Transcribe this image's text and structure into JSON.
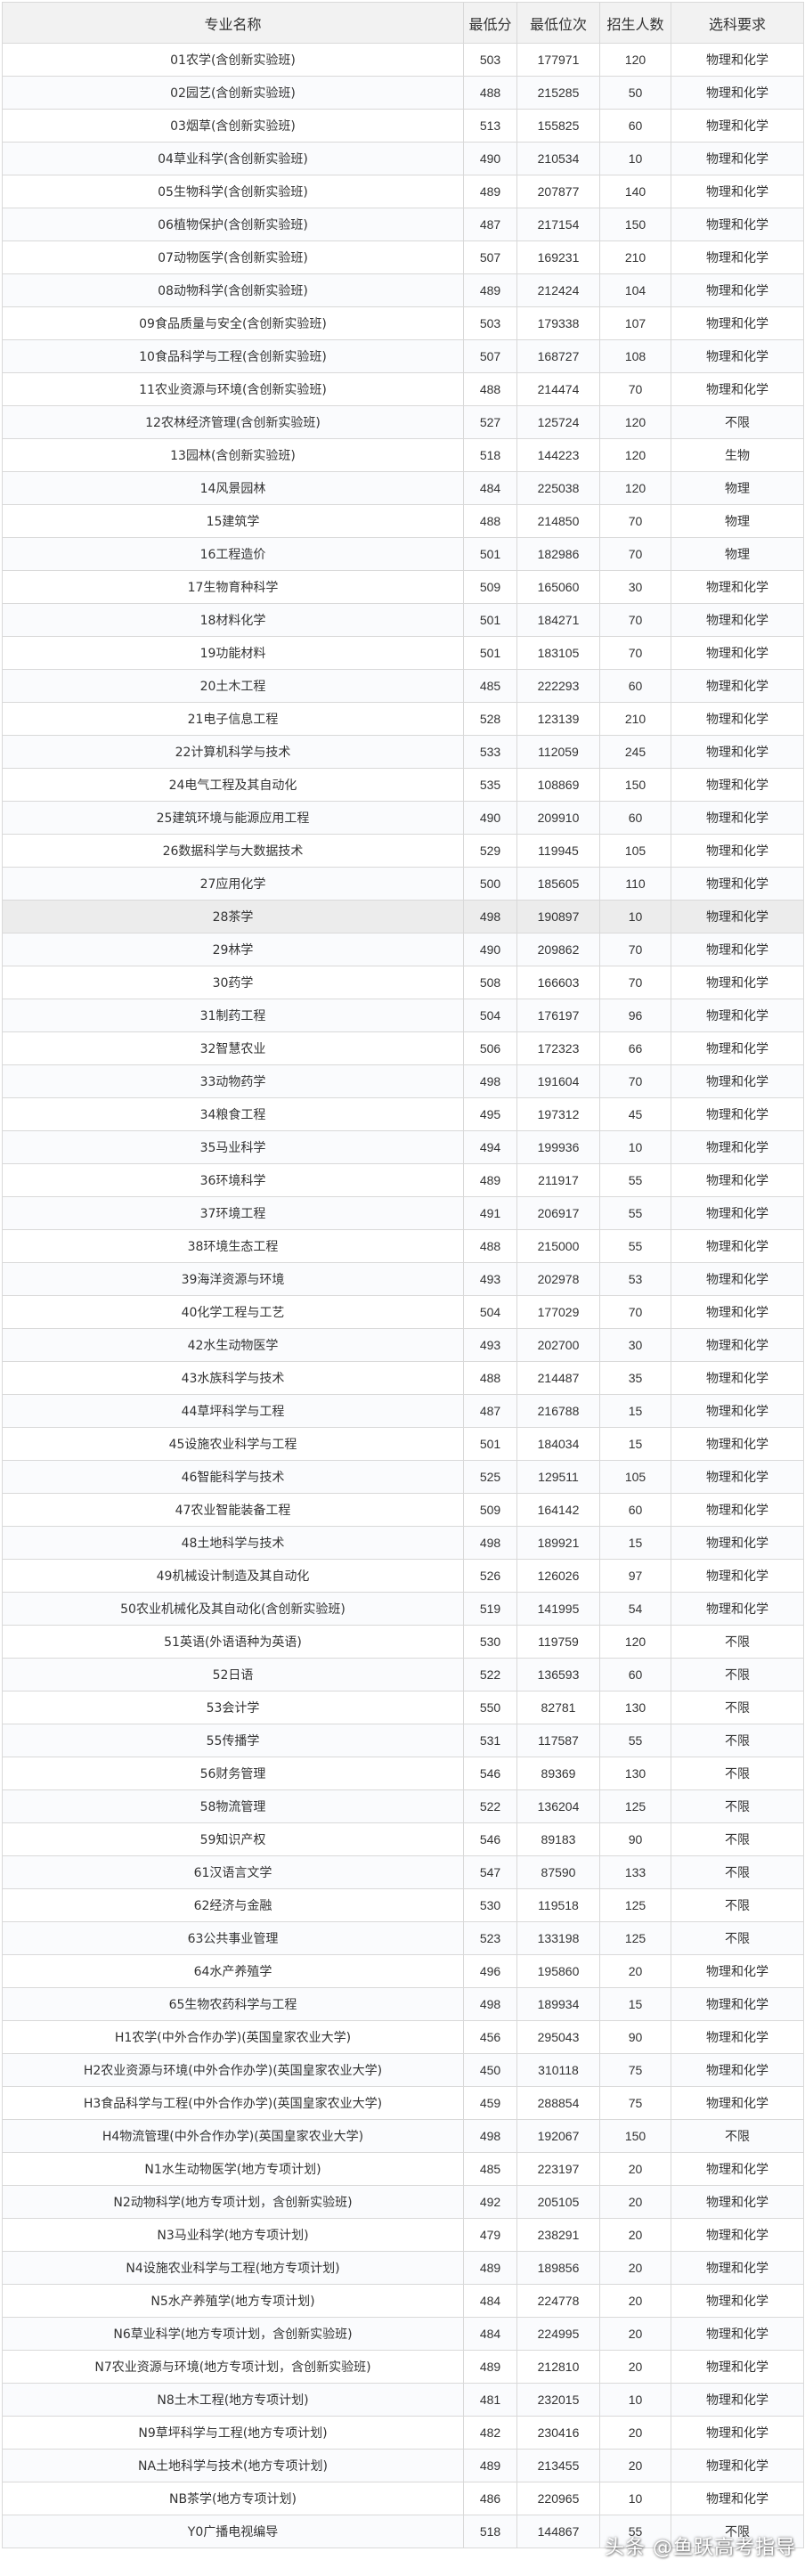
{
  "table": {
    "headers": [
      "专业名称",
      "最低分",
      "最低位次",
      "招生人数",
      "选科要求"
    ],
    "highlight_row": 27,
    "rows": [
      [
        "01农学(含创新实验班)",
        "503",
        "177971",
        "120",
        "物理和化学"
      ],
      [
        "02园艺(含创新实验班)",
        "488",
        "215285",
        "50",
        "物理和化学"
      ],
      [
        "03烟草(含创新实验班)",
        "513",
        "155825",
        "60",
        "物理和化学"
      ],
      [
        "04草业科学(含创新实验班)",
        "490",
        "210534",
        "10",
        "物理和化学"
      ],
      [
        "05生物科学(含创新实验班)",
        "489",
        "207877",
        "140",
        "物理和化学"
      ],
      [
        "06植物保护(含创新实验班)",
        "487",
        "217154",
        "150",
        "物理和化学"
      ],
      [
        "07动物医学(含创新实验班)",
        "507",
        "169231",
        "210",
        "物理和化学"
      ],
      [
        "08动物科学(含创新实验班)",
        "489",
        "212424",
        "104",
        "物理和化学"
      ],
      [
        "09食品质量与安全(含创新实验班)",
        "503",
        "179338",
        "107",
        "物理和化学"
      ],
      [
        "10食品科学与工程(含创新实验班)",
        "507",
        "168727",
        "108",
        "物理和化学"
      ],
      [
        "11农业资源与环境(含创新实验班)",
        "488",
        "214474",
        "70",
        "物理和化学"
      ],
      [
        "12农林经济管理(含创新实验班)",
        "527",
        "125724",
        "120",
        "不限"
      ],
      [
        "13园林(含创新实验班)",
        "518",
        "144223",
        "120",
        "生物"
      ],
      [
        "14风景园林",
        "484",
        "225038",
        "120",
        "物理"
      ],
      [
        "15建筑学",
        "488",
        "214850",
        "70",
        "物理"
      ],
      [
        "16工程造价",
        "501",
        "182986",
        "70",
        "物理"
      ],
      [
        "17生物育种科学",
        "509",
        "165060",
        "30",
        "物理和化学"
      ],
      [
        "18材料化学",
        "501",
        "184271",
        "70",
        "物理和化学"
      ],
      [
        "19功能材料",
        "501",
        "183105",
        "70",
        "物理和化学"
      ],
      [
        "20土木工程",
        "485",
        "222293",
        "60",
        "物理和化学"
      ],
      [
        "21电子信息工程",
        "528",
        "123139",
        "210",
        "物理和化学"
      ],
      [
        "22计算机科学与技术",
        "533",
        "112059",
        "245",
        "物理和化学"
      ],
      [
        "24电气工程及其自动化",
        "535",
        "108869",
        "150",
        "物理和化学"
      ],
      [
        "25建筑环境与能源应用工程",
        "490",
        "209910",
        "60",
        "物理和化学"
      ],
      [
        "26数据科学与大数据技术",
        "529",
        "119945",
        "105",
        "物理和化学"
      ],
      [
        "27应用化学",
        "500",
        "185605",
        "110",
        "物理和化学"
      ],
      [
        "28茶学",
        "498",
        "190897",
        "10",
        "物理和化学"
      ],
      [
        "29林学",
        "490",
        "209862",
        "70",
        "物理和化学"
      ],
      [
        "30药学",
        "508",
        "166603",
        "70",
        "物理和化学"
      ],
      [
        "31制药工程",
        "504",
        "176197",
        "96",
        "物理和化学"
      ],
      [
        "32智慧农业",
        "506",
        "172323",
        "66",
        "物理和化学"
      ],
      [
        "33动物药学",
        "498",
        "191604",
        "70",
        "物理和化学"
      ],
      [
        "34粮食工程",
        "495",
        "197312",
        "45",
        "物理和化学"
      ],
      [
        "35马业科学",
        "494",
        "199936",
        "10",
        "物理和化学"
      ],
      [
        "36环境科学",
        "489",
        "211917",
        "55",
        "物理和化学"
      ],
      [
        "37环境工程",
        "491",
        "206917",
        "55",
        "物理和化学"
      ],
      [
        "38环境生态工程",
        "488",
        "215000",
        "55",
        "物理和化学"
      ],
      [
        "39海洋资源与环境",
        "493",
        "202978",
        "53",
        "物理和化学"
      ],
      [
        "40化学工程与工艺",
        "504",
        "177029",
        "70",
        "物理和化学"
      ],
      [
        "42水生动物医学",
        "493",
        "202700",
        "30",
        "物理和化学"
      ],
      [
        "43水族科学与技术",
        "488",
        "214487",
        "35",
        "物理和化学"
      ],
      [
        "44草坪科学与工程",
        "487",
        "216788",
        "15",
        "物理和化学"
      ],
      [
        "45设施农业科学与工程",
        "501",
        "184034",
        "15",
        "物理和化学"
      ],
      [
        "46智能科学与技术",
        "525",
        "129511",
        "105",
        "物理和化学"
      ],
      [
        "47农业智能装备工程",
        "509",
        "164142",
        "60",
        "物理和化学"
      ],
      [
        "48土地科学与技术",
        "498",
        "189921",
        "15",
        "物理和化学"
      ],
      [
        "49机械设计制造及其自动化",
        "526",
        "126026",
        "97",
        "物理和化学"
      ],
      [
        "50农业机械化及其自动化(含创新实验班)",
        "519",
        "141995",
        "54",
        "物理和化学"
      ],
      [
        "51英语(外语语种为英语)",
        "530",
        "119759",
        "120",
        "不限"
      ],
      [
        "52日语",
        "522",
        "136593",
        "60",
        "不限"
      ],
      [
        "53会计学",
        "550",
        "82781",
        "130",
        "不限"
      ],
      [
        "55传播学",
        "531",
        "117587",
        "55",
        "不限"
      ],
      [
        "56财务管理",
        "546",
        "89369",
        "130",
        "不限"
      ],
      [
        "58物流管理",
        "522",
        "136204",
        "125",
        "不限"
      ],
      [
        "59知识产权",
        "546",
        "89183",
        "90",
        "不限"
      ],
      [
        "61汉语言文学",
        "547",
        "87590",
        "133",
        "不限"
      ],
      [
        "62经济与金融",
        "530",
        "119518",
        "125",
        "不限"
      ],
      [
        "63公共事业管理",
        "523",
        "133198",
        "125",
        "不限"
      ],
      [
        "64水产养殖学",
        "496",
        "195860",
        "20",
        "物理和化学"
      ],
      [
        "65生物农药科学与工程",
        "498",
        "189934",
        "15",
        "物理和化学"
      ],
      [
        "H1农学(中外合作办学)(英国皇家农业大学)",
        "456",
        "295043",
        "90",
        "物理和化学"
      ],
      [
        "H2农业资源与环境(中外合作办学)(英国皇家农业大学)",
        "450",
        "310118",
        "75",
        "物理和化学"
      ],
      [
        "H3食品科学与工程(中外合作办学)(英国皇家农业大学)",
        "459",
        "288854",
        "75",
        "物理和化学"
      ],
      [
        "H4物流管理(中外合作办学)(英国皇家农业大学)",
        "498",
        "192067",
        "150",
        "不限"
      ],
      [
        "N1水生动物医学(地方专项计划)",
        "485",
        "223197",
        "20",
        "物理和化学"
      ],
      [
        "N2动物科学(地方专项计划，含创新实验班)",
        "492",
        "205105",
        "20",
        "物理和化学"
      ],
      [
        "N3马业科学(地方专项计划)",
        "479",
        "238291",
        "20",
        "物理和化学"
      ],
      [
        "N4设施农业科学与工程(地方专项计划)",
        "489",
        "189856",
        "20",
        "物理和化学"
      ],
      [
        "N5水产养殖学(地方专项计划)",
        "484",
        "224778",
        "20",
        "物理和化学"
      ],
      [
        "N6草业科学(地方专项计划，含创新实验班)",
        "484",
        "224995",
        "20",
        "物理和化学"
      ],
      [
        "N7农业资源与环境(地方专项计划，含创新实验班)",
        "489",
        "212810",
        "20",
        "物理和化学"
      ],
      [
        "N8土木工程(地方专项计划)",
        "481",
        "232015",
        "10",
        "物理和化学"
      ],
      [
        "N9草坪科学与工程(地方专项计划)",
        "482",
        "230416",
        "20",
        "物理和化学"
      ],
      [
        "NA土地科学与技术(地方专项计划)",
        "489",
        "213455",
        "20",
        "物理和化学"
      ],
      [
        "NB茶学(地方专项计划)",
        "486",
        "220965",
        "10",
        "物理和化学"
      ],
      [
        "Y0广播电视编导",
        "518",
        "144867",
        "55",
        "不限"
      ]
    ]
  },
  "watermark": "头条 @鱼跃高考指导"
}
